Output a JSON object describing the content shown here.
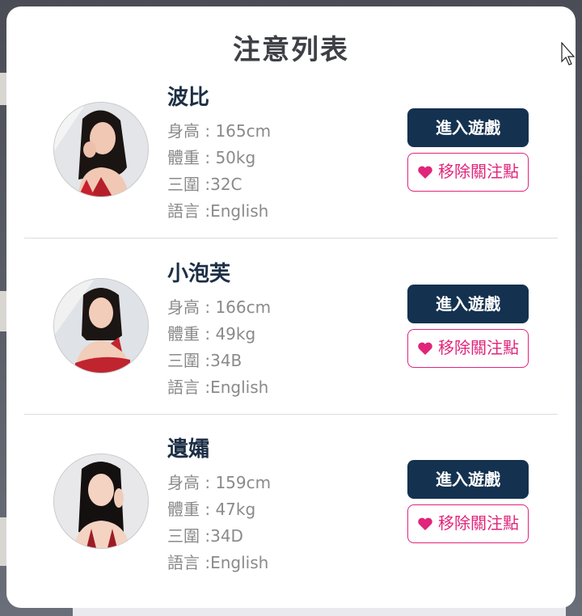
{
  "modal": {
    "title": "注意列表",
    "colors": {
      "primary_button": "#14314f",
      "accent_pink": "#e0257a",
      "name_text": "#1c2f45",
      "stat_text": "#8a8a8a"
    },
    "items": [
      {
        "name": "波比",
        "height": "身高 : 165cm",
        "weight": "體重 : 50kg",
        "measurements": "三圍 :32C",
        "language": "語言 :English",
        "enter_label": "進入遊戲",
        "remove_label": "移除關注點"
      },
      {
        "name": "小泡芙",
        "height": "身高 : 166cm",
        "weight": "體重 : 49kg",
        "measurements": "三圍 :34B",
        "language": "語言 :English",
        "enter_label": "進入遊戲",
        "remove_label": "移除關注點"
      },
      {
        "name": "遺孀",
        "height": "身高 : 159cm",
        "weight": "體重 : 47kg",
        "measurements": "三圍 :34D",
        "language": "語言 :English",
        "enter_label": "進入遊戲",
        "remove_label": "移除關注點"
      }
    ]
  },
  "icons": {
    "remove_icon": "heart-icon",
    "avatar": "profile-photo",
    "pointer": "mouse-cursor-icon"
  }
}
